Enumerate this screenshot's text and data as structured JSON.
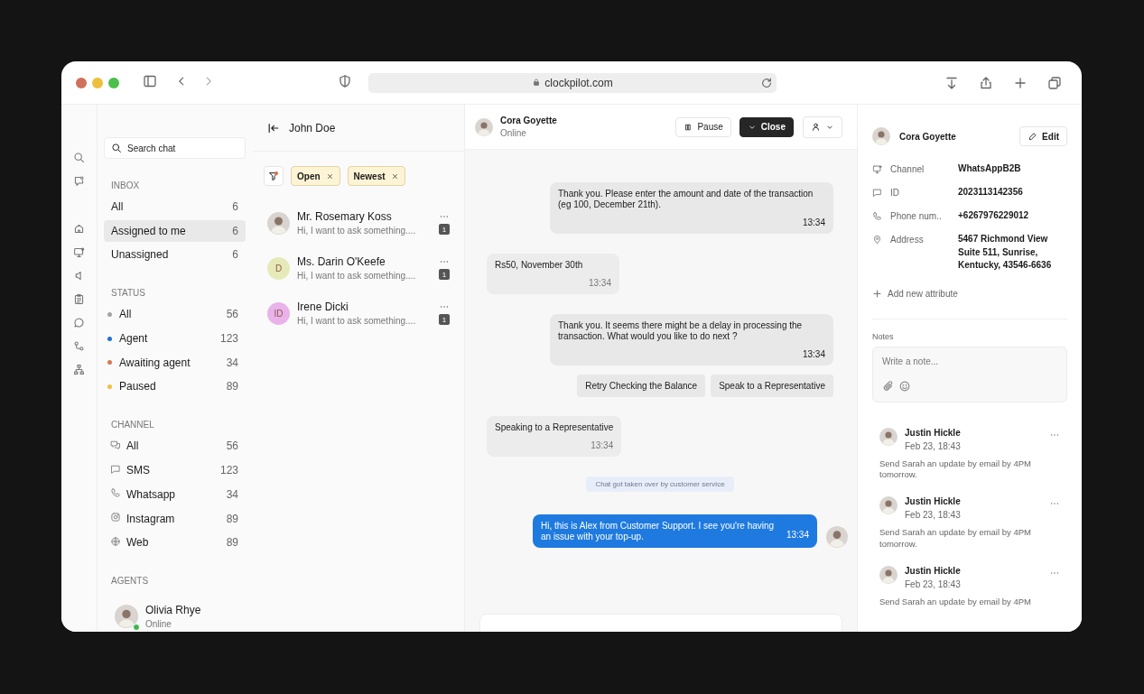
{
  "browser": {
    "url": "clockpilot.com"
  },
  "sidebar": {
    "search": {
      "placeholder": "Search chat"
    },
    "inbox": {
      "title": "INBOX",
      "items": [
        {
          "label": "All",
          "count": "6",
          "selected": false
        },
        {
          "label": "Assigned to me",
          "count": "6",
          "selected": true
        },
        {
          "label": "Unassigned",
          "count": "6",
          "selected": false
        }
      ]
    },
    "status": {
      "title": "STATUS",
      "items": [
        {
          "label": "All",
          "count": "56",
          "color": "#a3a3a3"
        },
        {
          "label": "Agent",
          "count": "123",
          "color": "#1f6fd6"
        },
        {
          "label": "Awaiting agent",
          "count": "34",
          "color": "#d9784f"
        },
        {
          "label": "Paused",
          "count": "89",
          "color": "#f0c03f"
        }
      ]
    },
    "channel": {
      "title": "CHANNEL",
      "items": [
        {
          "label": "All",
          "count": "56"
        },
        {
          "label": "SMS",
          "count": "123"
        },
        {
          "label": "Whatsapp",
          "count": "34"
        },
        {
          "label": "Instagram",
          "count": "89"
        },
        {
          "label": "Web",
          "count": "89"
        }
      ]
    },
    "agents": {
      "title": "AGENTS",
      "items": [
        {
          "name": "Olivia Rhye",
          "status": "Online",
          "online": true
        }
      ]
    }
  },
  "chat_list": {
    "title": "John Doe",
    "filters": [
      {
        "label": "Open"
      },
      {
        "label": "Newest"
      }
    ],
    "conversations": [
      {
        "name": "Mr. Rosemary Koss",
        "preview": "Hi, I want to ask something....",
        "unread": "1",
        "avatar": {
          "kind": "photo"
        }
      },
      {
        "name": "Ms. Darin O'Keefe",
        "preview": "Hi, I want to ask something....",
        "unread": "1",
        "avatar": {
          "kind": "initials",
          "initials": "D",
          "color": "#e6eab8"
        }
      },
      {
        "name": "Irene Dicki",
        "preview": "Hi, I want to ask something....",
        "unread": "1",
        "avatar": {
          "kind": "initials",
          "initials": "ID",
          "color": "#e9b2ea"
        }
      }
    ]
  },
  "chat": {
    "contact": {
      "name": "Cora Goyette",
      "status": "Online"
    },
    "pause": "Pause",
    "close": "Close",
    "messages": [
      {
        "kind": "bot",
        "text": "Thank you. Please enter the amount and date of the transaction (eg 100, December 21th).",
        "time": "13:34"
      },
      {
        "kind": "customer",
        "text": "Rs50, November 30th",
        "time": "13:34"
      },
      {
        "kind": "bot",
        "text": "Thank you. It seems there might be a delay in processing the transaction. What would you like to do next ?",
        "time": "13:34"
      },
      {
        "kind": "replies",
        "options": [
          "Retry Checking the Balance",
          "Speak to a Representative"
        ]
      },
      {
        "kind": "customer",
        "text": "Speaking to a Representative",
        "time": "13:34"
      },
      {
        "kind": "system",
        "text": "Chat got taken over by customer service"
      },
      {
        "kind": "agent",
        "text": "Hi, this is Alex from Customer Support. I see you're having an issue with your top-up.",
        "time": "13:34"
      }
    ]
  },
  "details": {
    "name": "Cora Goyette",
    "edit": "Edit",
    "attributes": [
      {
        "label": "Channel",
        "value": "WhatsAppB2B"
      },
      {
        "label": "ID",
        "value": "2023113142356"
      },
      {
        "label": "Phone num..",
        "value": "+6267976229012"
      },
      {
        "label": "Address",
        "value": "5467 Richmond View\nSuite 511, Sunrise,\nKentucky, 43546-6636"
      }
    ],
    "add_attribute": "Add new attribute",
    "notes": {
      "title": "Notes",
      "placeholder": "Write a note...",
      "items": [
        {
          "author": "Justin Hickle",
          "time": "Feb 23, 18:43",
          "text": "Send Sarah an update by email by 4PM tomorrow."
        },
        {
          "author": "Justin Hickle",
          "time": "Feb 23, 18:43",
          "text": "Send Sarah an update by email by 4PM tomorrow."
        },
        {
          "author": "Justin Hickle",
          "time": "Feb 23, 18:43",
          "text": "Send Sarah an update by email by 4PM"
        }
      ]
    }
  }
}
